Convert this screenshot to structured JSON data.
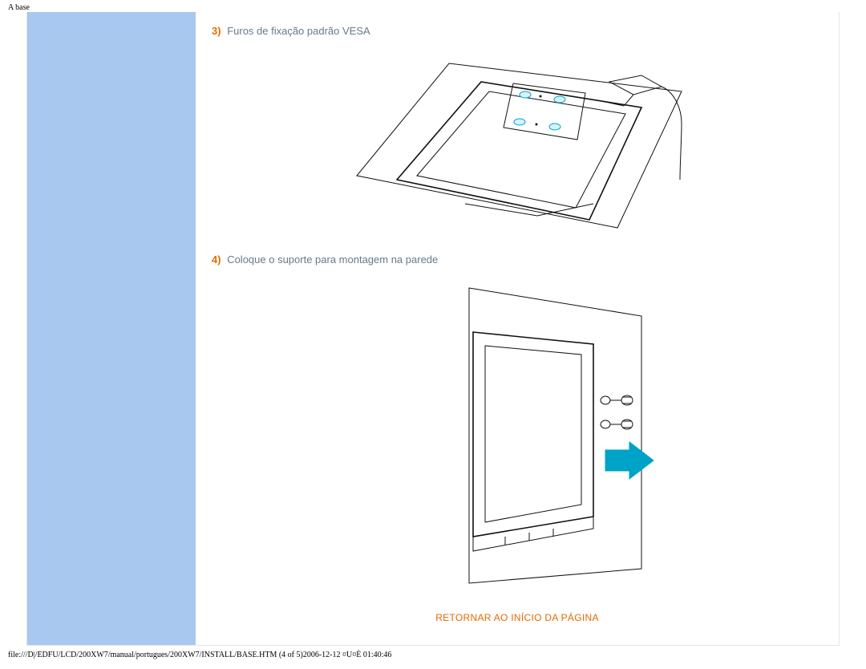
{
  "header_label": "A base",
  "steps": {
    "step3": {
      "num": "3)",
      "text": "Furos de fixação padrão VESA"
    },
    "step4": {
      "num": "4)",
      "text": "Coloque o suporte para montagem na parede"
    }
  },
  "footer_link": "RETORNAR AO INÍCIO DA PÁGINA",
  "page_footer": "file:///D|/EDFU/LCD/200XW7/manual/portugues/200XW7/INSTALL/BASE.HTM (4 of 5)2006-12-12 ¤U¤È 01:40:46"
}
